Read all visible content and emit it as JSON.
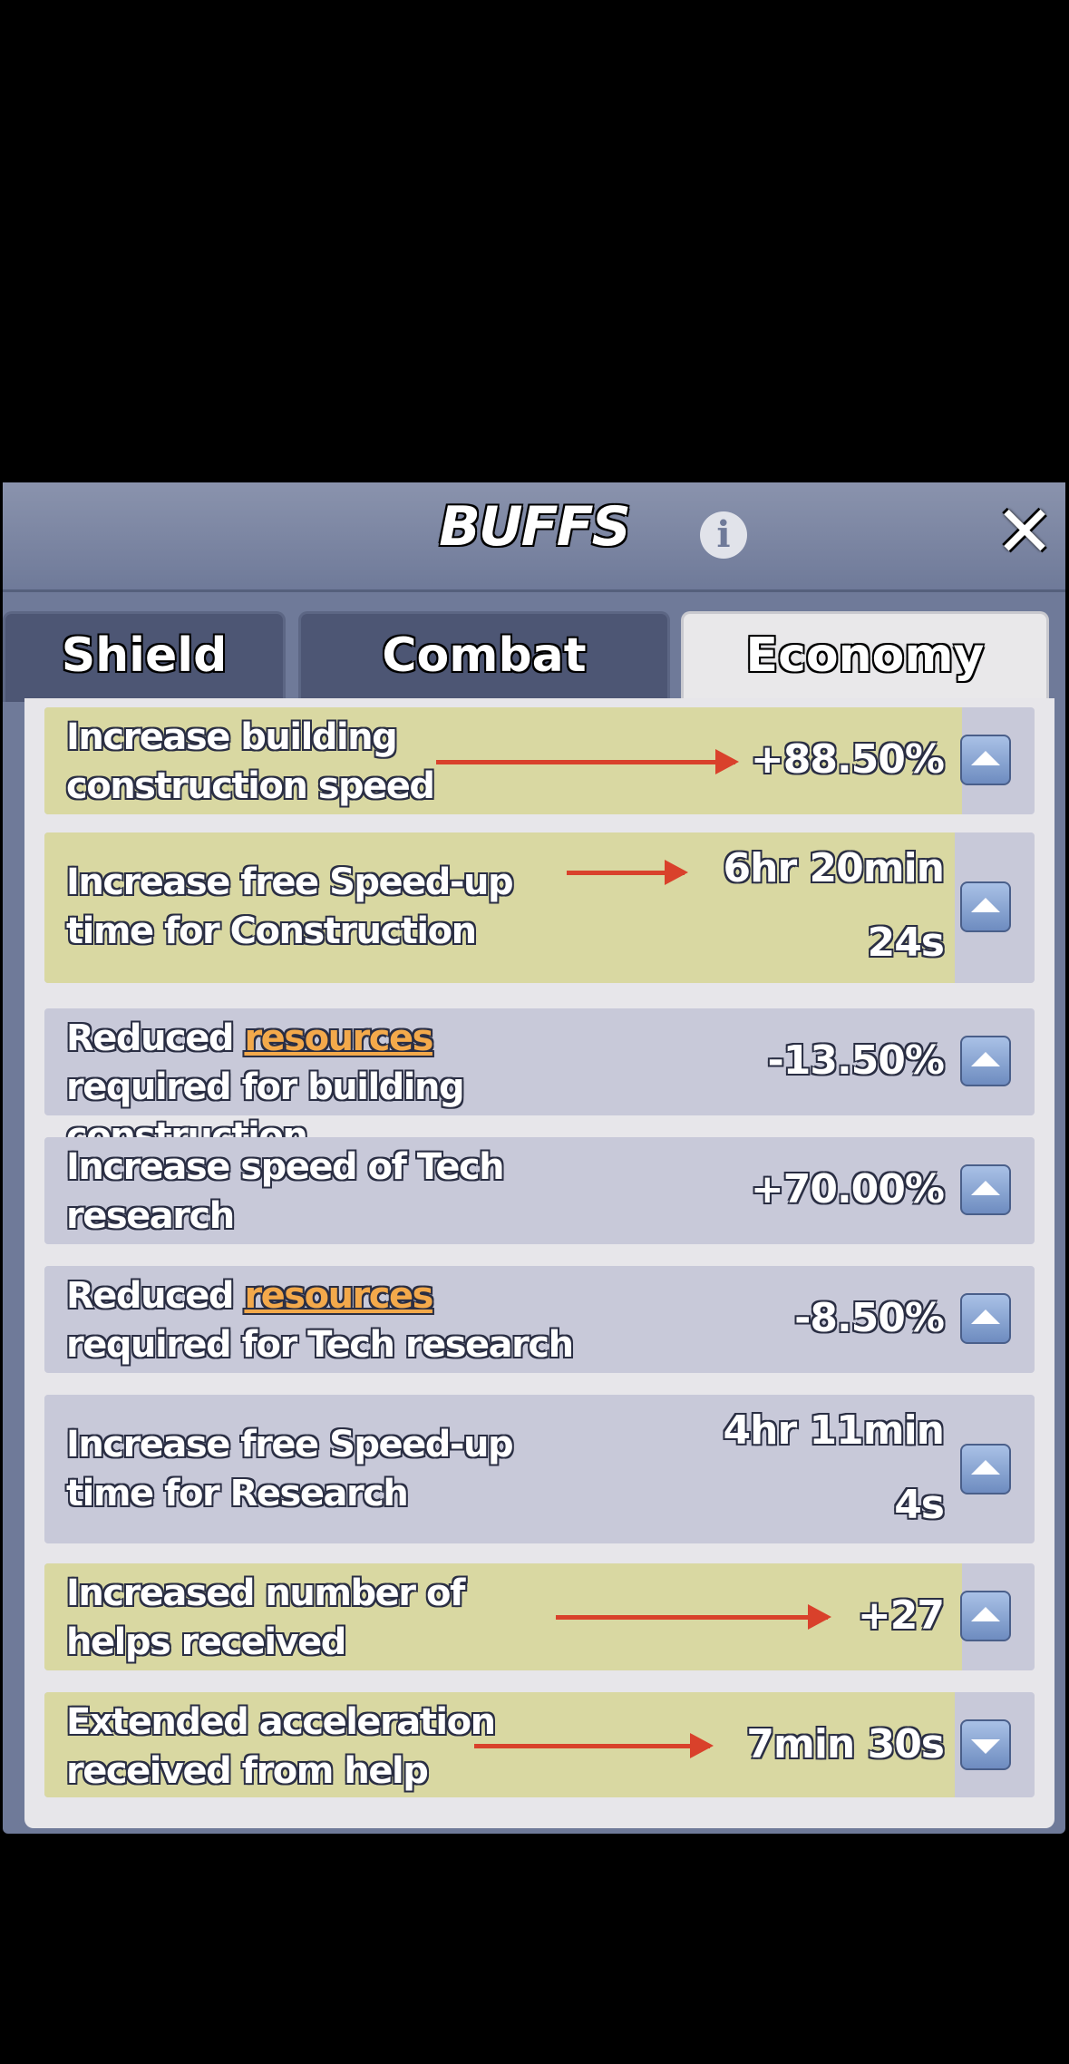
{
  "header": {
    "title": "BUFFS"
  },
  "tabs": [
    {
      "label": "Shield",
      "active": false
    },
    {
      "label": "Combat",
      "active": false
    },
    {
      "label": "Economy",
      "active": true
    }
  ],
  "buffs": [
    {
      "label": "Increase building construction speed",
      "value": "+88.50%",
      "highlighted": true,
      "toggle": "up"
    },
    {
      "label": "Increase free Speed-up time for Construction",
      "value_line1": "6hr 20min",
      "value_line2": "24s",
      "highlighted": true,
      "toggle": "up"
    },
    {
      "label_pre": "Reduced ",
      "label_link": "resources",
      "label_post": " required for building construction",
      "value": "-13.50%",
      "highlighted": false,
      "toggle": "up"
    },
    {
      "label": "Increase speed of Tech research",
      "value": "+70.00%",
      "highlighted": false,
      "toggle": "up"
    },
    {
      "label_pre": "Reduced ",
      "label_link": "resources",
      "label_post": " required for Tech research",
      "value": "-8.50%",
      "highlighted": false,
      "toggle": "up"
    },
    {
      "label": "Increase free Speed-up time for Research",
      "value_line1": "4hr 11min",
      "value_line2": "4s",
      "highlighted": false,
      "toggle": "up"
    },
    {
      "label": "Increased number of helps received",
      "value": "+27",
      "highlighted": true,
      "toggle": "up"
    },
    {
      "label": "Extended acceleration received from help",
      "value": "7min 30s",
      "highlighted": true,
      "toggle": "down"
    }
  ],
  "colors": {
    "highlight": "#d9d8a2",
    "row": "#c8c9d9",
    "arrow": "#d9412b",
    "link": "#f3a94b"
  },
  "icons": {
    "info": "info-icon",
    "close": "close-icon",
    "expand": "chevron-up-icon",
    "collapse": "chevron-down-icon"
  }
}
